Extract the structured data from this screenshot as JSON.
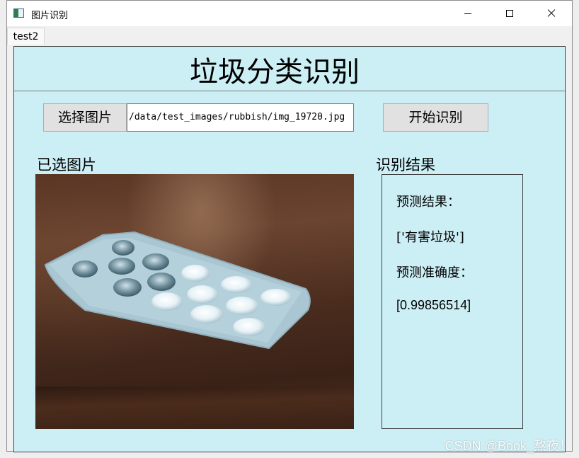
{
  "window": {
    "title": "图片识别",
    "tab_label": "test2"
  },
  "app": {
    "title": "垃圾分类识别",
    "select_button": "选择图片",
    "file_path": "/data/test_images/rubbish/img_19720.jpg",
    "start_button": "开始识别",
    "selected_label": "已选图片",
    "result_label": "识别结果"
  },
  "results": {
    "prediction_label": "预测结果：",
    "prediction_value": "['有害垃圾']",
    "accuracy_label": "预测准确度：",
    "accuracy_value": "[0.99856514]"
  },
  "watermark": "CSDN @Book_熬夜！",
  "colors": {
    "panel_bg": "#cceff5",
    "button_bg": "#e1e1e1"
  }
}
